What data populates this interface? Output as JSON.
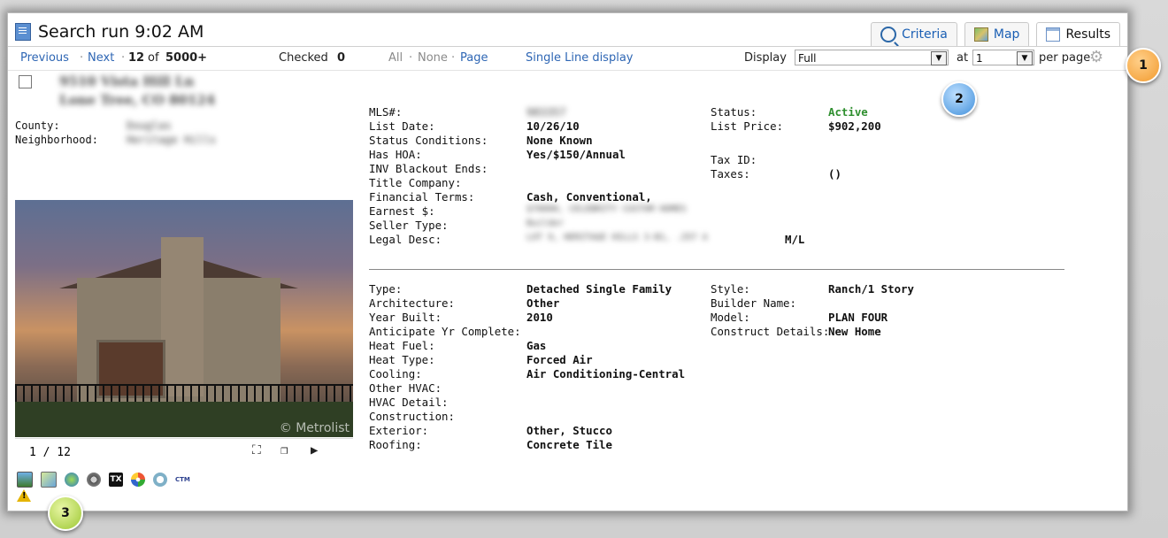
{
  "header": {
    "title": "Search run 9:02 AM",
    "tabs": [
      {
        "label": "Criteria",
        "icon": "magnifier-icon"
      },
      {
        "label": "Map",
        "icon": "map-icon"
      },
      {
        "label": "Results",
        "icon": "results-icon",
        "active": true
      }
    ]
  },
  "toolbar": {
    "previous": "Previous",
    "sep1": "·",
    "next": "Next",
    "sep2": "·",
    "position": "12",
    "of": "of",
    "total": "5000+",
    "checked_label": "Checked",
    "checked_count": "0",
    "all": "All",
    "none": "None",
    "page": "Page",
    "single_line": "Single Line display",
    "display_label": "Display",
    "display_value": "Full",
    "at_label": "at",
    "at_value": "1",
    "per_page": "per page"
  },
  "listing": {
    "address_line1": "9510 Vista Hill Ln",
    "address_line2": "Lone Tree, CO 80124",
    "county_label": "County:",
    "county_value": "Douglas",
    "neighborhood_label": "Neighborhood:",
    "neighborhood_value": "Heritage Hills",
    "photo_watermark": "© Metrolist",
    "photo_counter": "1 / 12"
  },
  "details": {
    "mls_label": "MLS#:",
    "mls_value": "983357",
    "list_date_label": "List Date:",
    "list_date_value": "10/26/10",
    "status_cond_label": "Status Conditions:",
    "status_cond_value": "None Known",
    "hoa_label": "Has HOA:",
    "hoa_value": "Yes/$150/Annual",
    "inv_label": "INV Blackout Ends:",
    "title_co_label": "Title Company:",
    "fin_label": "Financial Terms:",
    "fin_value": "Cash, Conventional,",
    "earnest_label": "Earnest $:",
    "earnest_value": "$70000, CELEBRITY CUSTOM HOMES",
    "seller_label": "Seller Type:",
    "seller_value": "Builder",
    "legal_label": "Legal Desc:",
    "legal_value": "LOT 9, HERITAGE HILLS 3-B1, .257 A",
    "legal_suffix": "M/L",
    "status_label": "Status:",
    "status_value": "Active",
    "list_price_label": "List Price:",
    "list_price_value": "$902,200",
    "tax_id_label": "Tax ID:",
    "taxes_label": "Taxes:",
    "taxes_value": "()",
    "type_label": "Type:",
    "type_value": "Detached Single Family",
    "arch_label": "Architecture:",
    "arch_value": "Other",
    "year_label": "Year Built:",
    "year_value": "2010",
    "anticipate_label": "Anticipate Yr Complete:",
    "heat_fuel_label": "Heat Fuel:",
    "heat_fuel_value": "Gas",
    "heat_type_label": "Heat Type:",
    "heat_type_value": "Forced Air",
    "cooling_label": "Cooling:",
    "cooling_value": "Air Conditioning-Central",
    "other_hvac_label": "Other HVAC:",
    "hvac_detail_label": "HVAC Detail:",
    "construction_label": "Construction:",
    "exterior_label": "Exterior:",
    "exterior_value": "Other, Stucco",
    "roofing_label": "Roofing:",
    "roofing_value": "Concrete Tile",
    "style_label": "Style:",
    "style_value": "Ranch/1 Story",
    "builder_label": "Builder Name:",
    "model_label": "Model:",
    "model_value": "PLAN FOUR",
    "construct_label": "Construct Details:",
    "construct_value": "New Home"
  },
  "tool_icons": [
    "photo-icon",
    "map-thumb-icon",
    "globe-icon",
    "settings-wheel-icon",
    "tx-icon",
    "arrows-icon",
    "refresh-icon",
    "ctm-icon"
  ],
  "tool_icon_labels": {
    "tx": "TX",
    "ctm": "CTM"
  },
  "warning": "!",
  "callouts": [
    "1",
    "2",
    "3"
  ],
  "colors": {
    "link": "#2e66b4",
    "active_status": "#2f8f2f",
    "badge1": "#f29a2e",
    "badge2": "#3f8fdb",
    "badge3": "#9cc732"
  }
}
